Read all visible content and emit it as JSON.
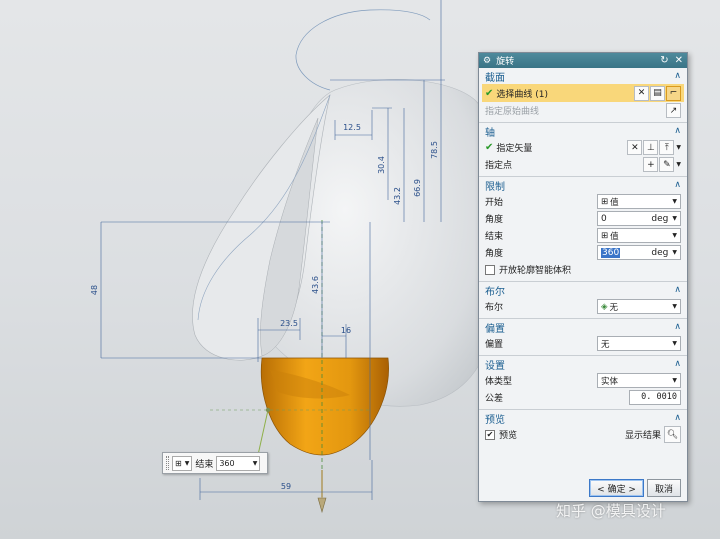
{
  "viewport": {
    "dims": {
      "d1": "12.5",
      "d2": "78.5",
      "d3": "30.4",
      "d4": "43.2",
      "d5": "66.9",
      "d6": "48",
      "d7": "43.6",
      "d8": "23.5",
      "d9": "16",
      "d10": "59"
    },
    "float_widget": {
      "type_icon": "value-icon",
      "label": "结束",
      "value": "360"
    }
  },
  "dialog": {
    "title": "旋转",
    "sections": {
      "section_curve": {
        "title": "截面",
        "select_curve": "选择曲线 (1)",
        "specify_origin_curve": "指定原始曲线"
      },
      "axis": {
        "title": "轴",
        "specify_vector": "指定矢量",
        "specify_point": "指定点"
      },
      "limits": {
        "title": "限制",
        "start_label": "开始",
        "start_value": "值",
        "angle1_label": "角度",
        "angle1_value": "0",
        "angle1_unit": "deg",
        "end_label": "结束",
        "end_value": "值",
        "angle2_label": "角度",
        "angle2_value": "360",
        "angle2_unit": "deg",
        "open_profile": "开放轮廓智能体积"
      },
      "boolean": {
        "title": "布尔",
        "label": "布尔",
        "value": "无"
      },
      "offset": {
        "title": "偏置",
        "label": "偏置",
        "value": "无"
      },
      "settings": {
        "title": "设置",
        "body_type_label": "体类型",
        "body_type_value": "实体",
        "tolerance_label": "公差",
        "tolerance_value": "0. 0010"
      },
      "preview": {
        "title": "预览",
        "preview_label": "预览",
        "show_result": "显示结果"
      }
    },
    "buttons": {
      "ok": "< 确定 >",
      "cancel": "取消"
    }
  },
  "watermark": "知乎 @模具设计",
  "colors": {
    "accent": "#1c5f91",
    "selection": "#f9d77a",
    "solid_orange": "#e3970f"
  }
}
